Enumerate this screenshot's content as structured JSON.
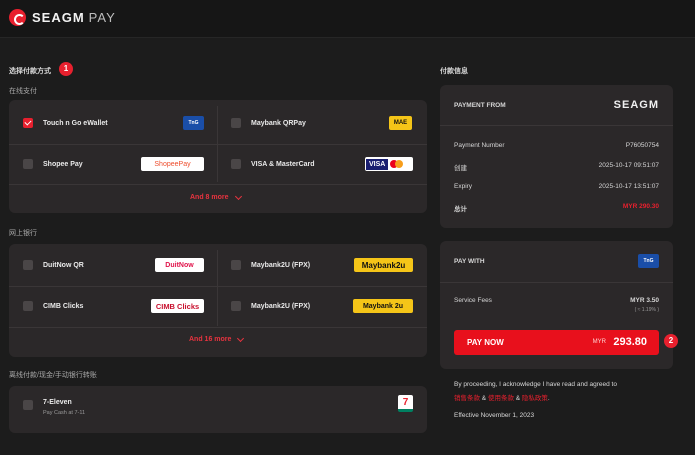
{
  "brand": {
    "name": "SEAGM",
    "suffix": "PAY"
  },
  "sections": {
    "choose_method": "选择付款方式",
    "choose_method_step": "1",
    "online_payment": "在线支付",
    "online_banking": "网上银行",
    "cash_payment": "离线付款/现金/手动银行转账"
  },
  "online_payment_options": [
    {
      "label": "Touch n Go eWallet",
      "checked": true,
      "logo": "TnG"
    },
    {
      "label": "Maybank QRPay",
      "checked": false,
      "logo": "MAE"
    },
    {
      "label": "Shopee Pay",
      "checked": false,
      "logo": "ShopeePay"
    },
    {
      "label": "VISA & MasterCard",
      "checked": false,
      "logo": "VISA"
    }
  ],
  "online_payment_more": "And 8 more",
  "banking_options": [
    {
      "label": "DuitNow QR",
      "checked": false,
      "logo": "DuitNow"
    },
    {
      "label": "Maybank2U (FPX)",
      "checked": false,
      "logo": "Maybank2u"
    },
    {
      "label": "CIMB Clicks",
      "checked": false,
      "logo": "CIMB Clicks"
    },
    {
      "label": "Maybank2U (FPX)",
      "checked": false,
      "logo": "Maybank 2u"
    }
  ],
  "banking_more": "And 16 more",
  "cash_options": [
    {
      "label": "7-Eleven",
      "sub": "Pay Cash at 7-11",
      "checked": false,
      "logo": "7"
    }
  ],
  "order_panel": {
    "title": "付款信息",
    "payment_from_label": "PAYMENT FROM",
    "payment_from_brand": "SEAGM",
    "rows": [
      {
        "label": "Payment Number",
        "value": "P76050754"
      },
      {
        "label": "创建",
        "value": "2025-10-17 09:51:07"
      },
      {
        "label": "Expiry",
        "value": "2025-10-17 13:51:07"
      },
      {
        "label": "总计",
        "value": "MYR 290.30"
      }
    ]
  },
  "pay_panel": {
    "pay_with_label": "PAY WITH",
    "service_fee_label": "Service Fees",
    "service_fee_value": "MYR 3.50",
    "service_fee_pct": "( ≈ 1.19% )",
    "pay_now_label": "PAY NOW",
    "currency": "MYR",
    "amount": "293.80",
    "step": "2"
  },
  "legal": {
    "text": "By proceeding, I acknowledge I have read and agreed to",
    "link1": "销售条款",
    "link2": "使用条款",
    "and": " & ",
    "link3": "隐私政策",
    "end": ".",
    "effective": "Effective November 1, 2023"
  },
  "colors": {
    "accent": "#e8202e",
    "bg": "#1c1c1c",
    "card": "#2b2829"
  }
}
